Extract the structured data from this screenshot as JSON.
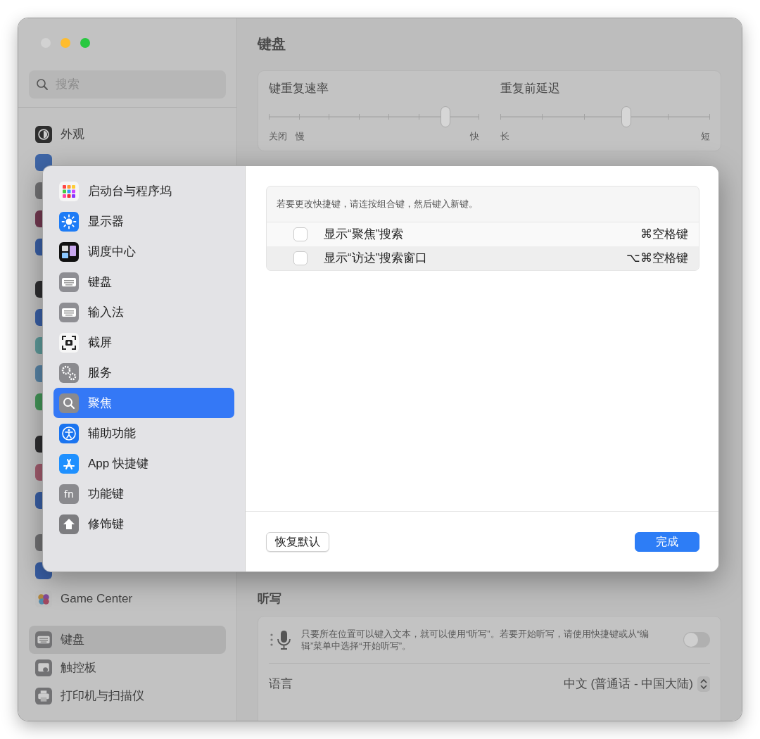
{
  "window_controls": [
    {
      "kind": "close",
      "enabled": false
    },
    {
      "kind": "minimize",
      "enabled": true
    },
    {
      "kind": "zoom",
      "enabled": true
    }
  ],
  "sidebar": {
    "search": {
      "placeholder": "搜索"
    },
    "sections": [
      {
        "items": [
          {
            "label": "外观",
            "kind": "appearance",
            "selected": false
          }
        ]
      },
      {
        "items": [
          {
            "label": "Game Center",
            "kind": "gamecenter",
            "selected": false
          }
        ]
      },
      {
        "items": [
          {
            "label": "键盘",
            "kind": "keyboard",
            "selected": true
          },
          {
            "label": "触控板",
            "kind": "trackpad",
            "selected": false
          },
          {
            "label": "打印机与扫描仪",
            "kind": "printer",
            "selected": false
          }
        ]
      }
    ]
  },
  "main": {
    "title": "键盘",
    "sliders": [
      {
        "label": "键重复速率",
        "start_labels": [
          "关闭",
          "慢"
        ],
        "end_label": "快",
        "level": 0.84
      },
      {
        "label": "重复前延迟",
        "start_labels": [
          "长"
        ],
        "end_label": "短",
        "level": 0.6
      }
    ],
    "dictation": {
      "heading": "听写",
      "description": "只要所在位置可以键入文本，就可以使用“听写”。若要开始听写，请使用快捷键或从“编辑”菜单中选择“开始听写”。",
      "on": false,
      "language": {
        "label": "语言",
        "value": "中文 (普通话 - 中国大陆)"
      }
    }
  },
  "dialog": {
    "sidebar": [
      {
        "label": "启动台与程序坞",
        "kind": "launchpad",
        "selected": false
      },
      {
        "label": "显示器",
        "kind": "display",
        "selected": false
      },
      {
        "label": "调度中心",
        "kind": "mission",
        "selected": false
      },
      {
        "label": "键盘",
        "kind": "keyboard",
        "selected": false
      },
      {
        "label": "输入法",
        "kind": "keyboard",
        "selected": false
      },
      {
        "label": "截屏",
        "kind": "screenshot",
        "selected": false
      },
      {
        "label": "服务",
        "kind": "services",
        "selected": false
      },
      {
        "label": "聚焦",
        "kind": "spotlight",
        "selected": true
      },
      {
        "label": "辅助功能",
        "kind": "accessibility",
        "selected": false
      },
      {
        "label": "App 快捷键",
        "kind": "appstore",
        "selected": false
      },
      {
        "label": "功能键",
        "kind": "fn",
        "icon_text": "fn",
        "selected": false
      },
      {
        "label": "修饰键",
        "kind": "modifier",
        "selected": false
      }
    ],
    "hint": "若要更改快捷键，请连按组合键，然后键入新键。",
    "shortcuts": [
      {
        "label": "显示“聚焦”搜索",
        "keys": "⌘空格键",
        "checked": false
      },
      {
        "label": "显示“访达”搜索窗口",
        "keys": "⌥⌘空格键",
        "checked": false
      }
    ],
    "buttons": [
      {
        "label": "恢复默认",
        "kind": "secondary"
      },
      {
        "label": "完成",
        "kind": "primary"
      }
    ]
  }
}
